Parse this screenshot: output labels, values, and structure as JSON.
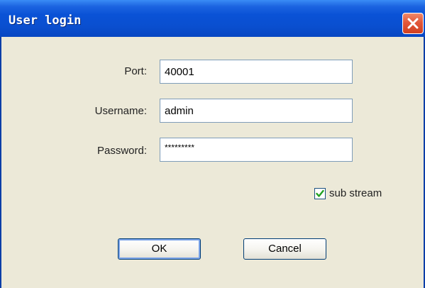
{
  "window": {
    "title": "User login",
    "close_icon": "close-icon"
  },
  "form": {
    "port_label": "Port:",
    "port_value": "40001",
    "username_label": "Username:",
    "username_value": "admin",
    "password_label": "Password:",
    "password_value": "*********",
    "sub_stream_label": "sub stream",
    "sub_stream_checked": true
  },
  "buttons": {
    "ok_label": "OK",
    "cancel_label": "Cancel"
  },
  "colors": {
    "titlebar": "#0a52d6",
    "close_button": "#e2573a",
    "dialog_background": "#ece9d8"
  }
}
